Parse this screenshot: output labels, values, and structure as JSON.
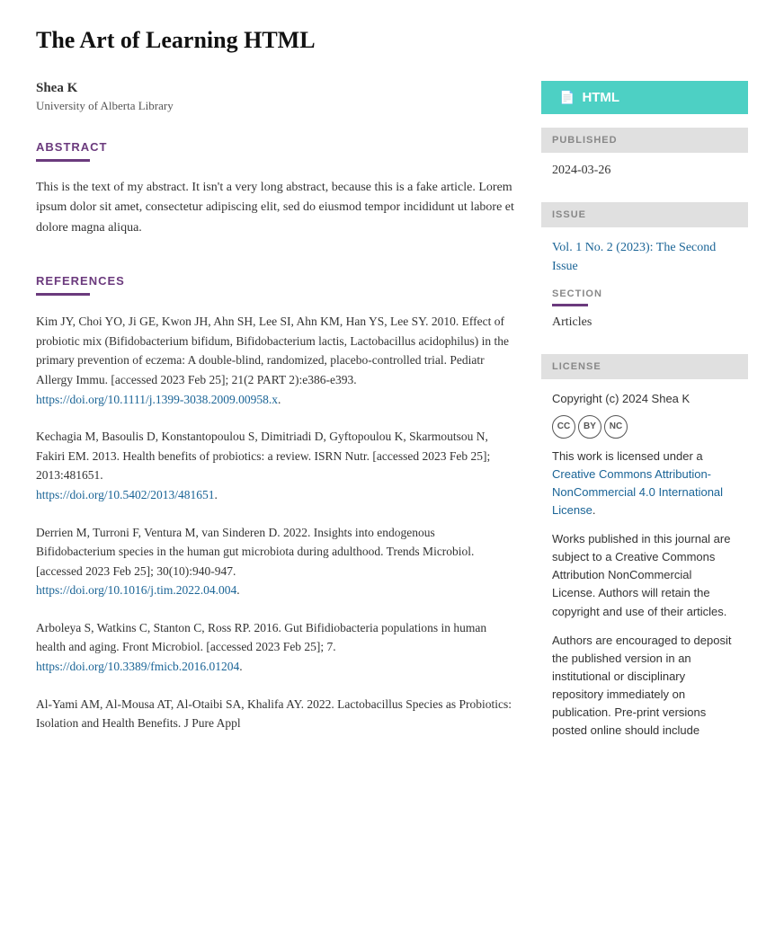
{
  "page": {
    "title": "The Art of Learning HTML"
  },
  "author": {
    "name": "Shea K",
    "affiliation": "University of Alberta Library"
  },
  "abstract": {
    "heading": "ABSTRACT",
    "text": "This is the text of my abstract. It isn't a very long abstract, because this is a fake article. Lorem ipsum dolor sit amet, consectetur adipiscing elit, sed do eiusmod tempor incididunt ut labore et dolore magna aliqua."
  },
  "references": {
    "heading": "REFERENCES",
    "items": [
      {
        "text": "Kim JY, Choi YO, Ji GE, Kwon JH, Ahn SH, Lee SI, Ahn KM, Han YS, Lee SY. 2010. Effect of probiotic mix (Bifidobacterium bifidum, Bifidobacterium lactis, Lactobacillus acidophilus) in the primary prevention of eczema: A double-blind, randomized, placebo-controlled trial. Pediatr Allergy Immu. [accessed 2023 Feb 25]; 21(2 PART 2):e386-e393.",
        "doi_text": "https://doi.org/10.1111/j.1399-3038.2009.00958.x",
        "doi_url": "https://doi.org/10.1111/j.1399-3038.2009.00958.x"
      },
      {
        "text": "Kechagia M, Basoulis D, Konstantopoulou S, Dimitriadi D, Gyftopoulou K, Skarmoutsou N, Fakiri EM. 2013. Health benefits of probiotics: a review. ISRN Nutr. [accessed 2023 Feb 25]; 2013:481651.",
        "doi_text": "https://doi.org/10.5402/2013/481651",
        "doi_url": "https://doi.org/10.5402/2013/481651"
      },
      {
        "text": "Derrien M, Turroni F, Ventura M, van Sinderen D. 2022. Insights into endogenous Bifidobacterium species in the human gut microbiota during adulthood. Trends Microbiol. [accessed 2023 Feb 25]; 30(10):940-947.",
        "doi_text": "https://doi.org/10.1016/j.tim.2022.04.004",
        "doi_url": "https://doi.org/10.1016/j.tim.2022.04.004"
      },
      {
        "text": "Arboleya S, Watkins C, Stanton C, Ross RP. 2016. Gut Bifidiobacteria populations in human health and aging. Front Microbiol. [accessed 2023 Feb 25]; 7.",
        "doi_text": "https://doi.org/10.3389/fmicb.2016.01204",
        "doi_url": "https://doi.org/10.3389/fmicb.2016.01204"
      },
      {
        "text": "Al-Yami AM, Al-Mousa AT, Al-Otaibi SA, Khalifa AY. 2022. Lactobacillus Species as Probiotics: Isolation and Health Benefits. J Pure Appl",
        "doi_text": "",
        "doi_url": ""
      }
    ]
  },
  "sidebar": {
    "html_button_label": "HTML",
    "published": {
      "heading": "PUBLISHED",
      "date": "2024-03-26"
    },
    "issue": {
      "heading": "ISSUE",
      "link_text": "Vol. 1 No. 2 (2023): The Second Issue",
      "link_url": "#"
    },
    "section": {
      "heading": "SECTION",
      "value": "Articles"
    },
    "license": {
      "heading": "LICENSE",
      "copyright": "Copyright (c) 2024 Shea K",
      "cc_labels": [
        "CC",
        "BY",
        "NC"
      ],
      "license_link_text": "Creative Commons Attribution-NonCommercial 4.0 International License",
      "license_link_url": "#",
      "intro": "This work is licensed under a ",
      "license_suffix": ".",
      "para2": "Works published in this journal are subject to a Creative Commons Attribution NonCommercial License. Authors will retain the copyright and use of their articles.",
      "para3": "Authors are encouraged to deposit the published version in an institutional or disciplinary repository immediately on publication. Pre-print versions posted online should include"
    }
  }
}
